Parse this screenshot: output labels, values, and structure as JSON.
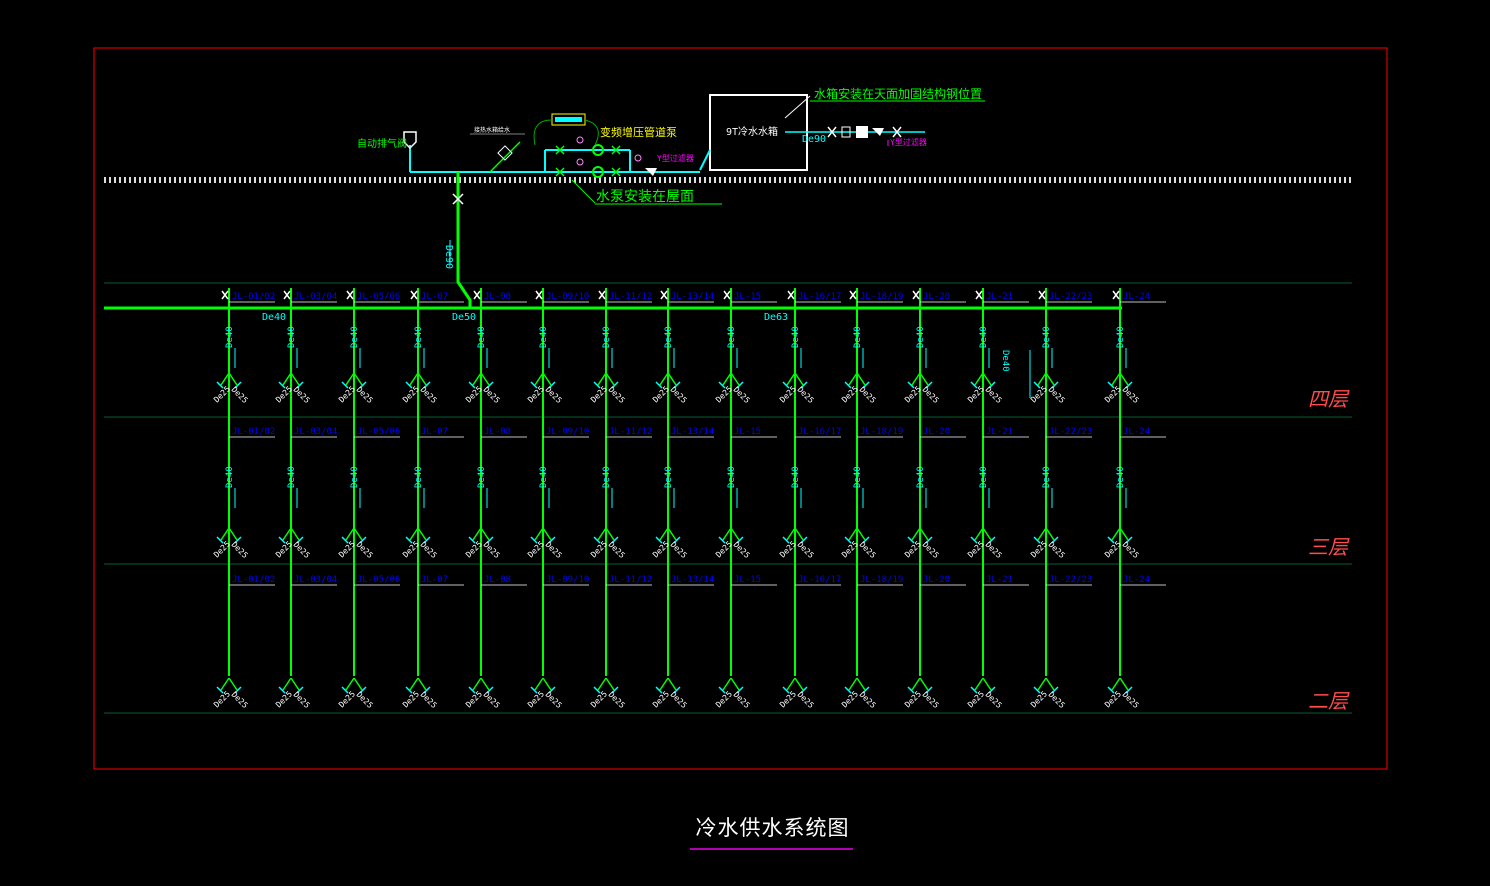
{
  "drawing": {
    "title": "冷水供水系统图",
    "notes": {
      "tank_position": "水箱安装在天面加固结构钢位置",
      "tank_label": "9T冷水水箱",
      "tank_pipe": "De90",
      "pump_note": "变频增压管道泵",
      "pump_location": "水泵安装在屋面",
      "air_valve": "自动排气阀",
      "tank_drain": "接热水箱给水",
      "y_filter_1": "Y型过滤器",
      "y_filter_2": "Y型过滤器",
      "riser_main": "De90"
    },
    "floors": [
      "四层",
      "三层",
      "二层"
    ],
    "main_pipe_sizes": [
      "De40",
      "De50",
      "De63"
    ],
    "branch_size": "De40",
    "fixture_size": "De25",
    "risers": [
      "JL-01/02",
      "JL-03/04",
      "JL-05/06",
      "JL-07",
      "JL-08",
      "JL-09/10",
      "JL-11/12",
      "JL-13/14",
      "JL-15",
      "JL-16/17",
      "JL-18/19",
      "JL-20",
      "JL-21",
      "JL-22/23",
      "JL-24"
    ],
    "colors": {
      "pipe": "#00ff00",
      "dim": "#00ffff",
      "label": "#0000ff",
      "floor_text": "#ff4d4d",
      "note": "#00ff00",
      "note_yellow": "#ffff00",
      "frame": "#ff0000"
    }
  }
}
